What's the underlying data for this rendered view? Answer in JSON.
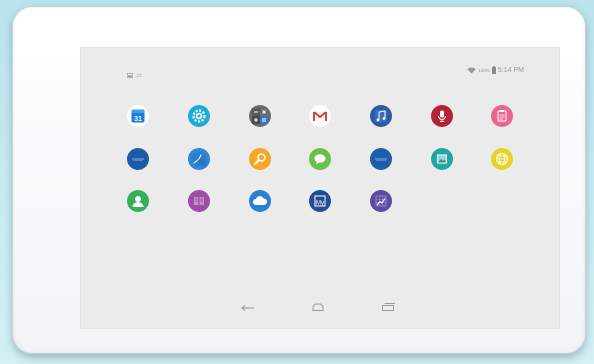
{
  "status_bar": {
    "battery_percent": "100%",
    "time": "5:14 PM"
  },
  "apps": [
    {
      "name": "calendar",
      "icon": "calendar-icon",
      "label": "31",
      "color": "#1e7bd8"
    },
    {
      "name": "settings",
      "icon": "gear-icon",
      "color": "#1dabd9"
    },
    {
      "name": "calculator",
      "icon": "calculator-icon",
      "color": "#6a6a6a"
    },
    {
      "name": "gmail",
      "icon": "gmail-icon",
      "color": "#ffffff"
    },
    {
      "name": "music",
      "icon": "music-icon",
      "color": "#2c5aa8"
    },
    {
      "name": "voice-recorder",
      "icon": "microphone-icon",
      "color": "#b52137"
    },
    {
      "name": "notes",
      "icon": "clipboard-icon",
      "color": "#e9678d"
    },
    {
      "name": "tv",
      "icon": "tv-icon",
      "color": "#1e5aa5"
    },
    {
      "name": "clock",
      "icon": "clock-icon",
      "color": "#2e86d4"
    },
    {
      "name": "search",
      "icon": "search-icon",
      "color": "#f5a623"
    },
    {
      "name": "messaging",
      "icon": "chat-icon",
      "color": "#6cbf4e"
    },
    {
      "name": "video",
      "icon": "tv-icon",
      "color": "#1d5ea8"
    },
    {
      "name": "gallery",
      "icon": "gallery-icon",
      "color": "#21a6a6"
    },
    {
      "name": "browser",
      "icon": "globe-icon",
      "color": "#e6d327"
    },
    {
      "name": "contacts",
      "icon": "person-icon",
      "color": "#35b05a"
    },
    {
      "name": "ebook",
      "icon": "book-icon",
      "color": "#9c4ea5"
    },
    {
      "name": "cloud",
      "icon": "cloud-icon",
      "color": "#2d7fcf"
    },
    {
      "name": "my-app",
      "icon": "my-icon",
      "label": "My",
      "color": "#234e92"
    },
    {
      "name": "stocks",
      "icon": "chart-icon",
      "color": "#5b4aa3"
    }
  ],
  "navigation": {
    "buttons": [
      {
        "name": "back",
        "icon": "back-arrow-icon"
      },
      {
        "name": "home",
        "icon": "home-icon"
      },
      {
        "name": "recent-apps",
        "icon": "recent-apps-icon"
      }
    ]
  }
}
